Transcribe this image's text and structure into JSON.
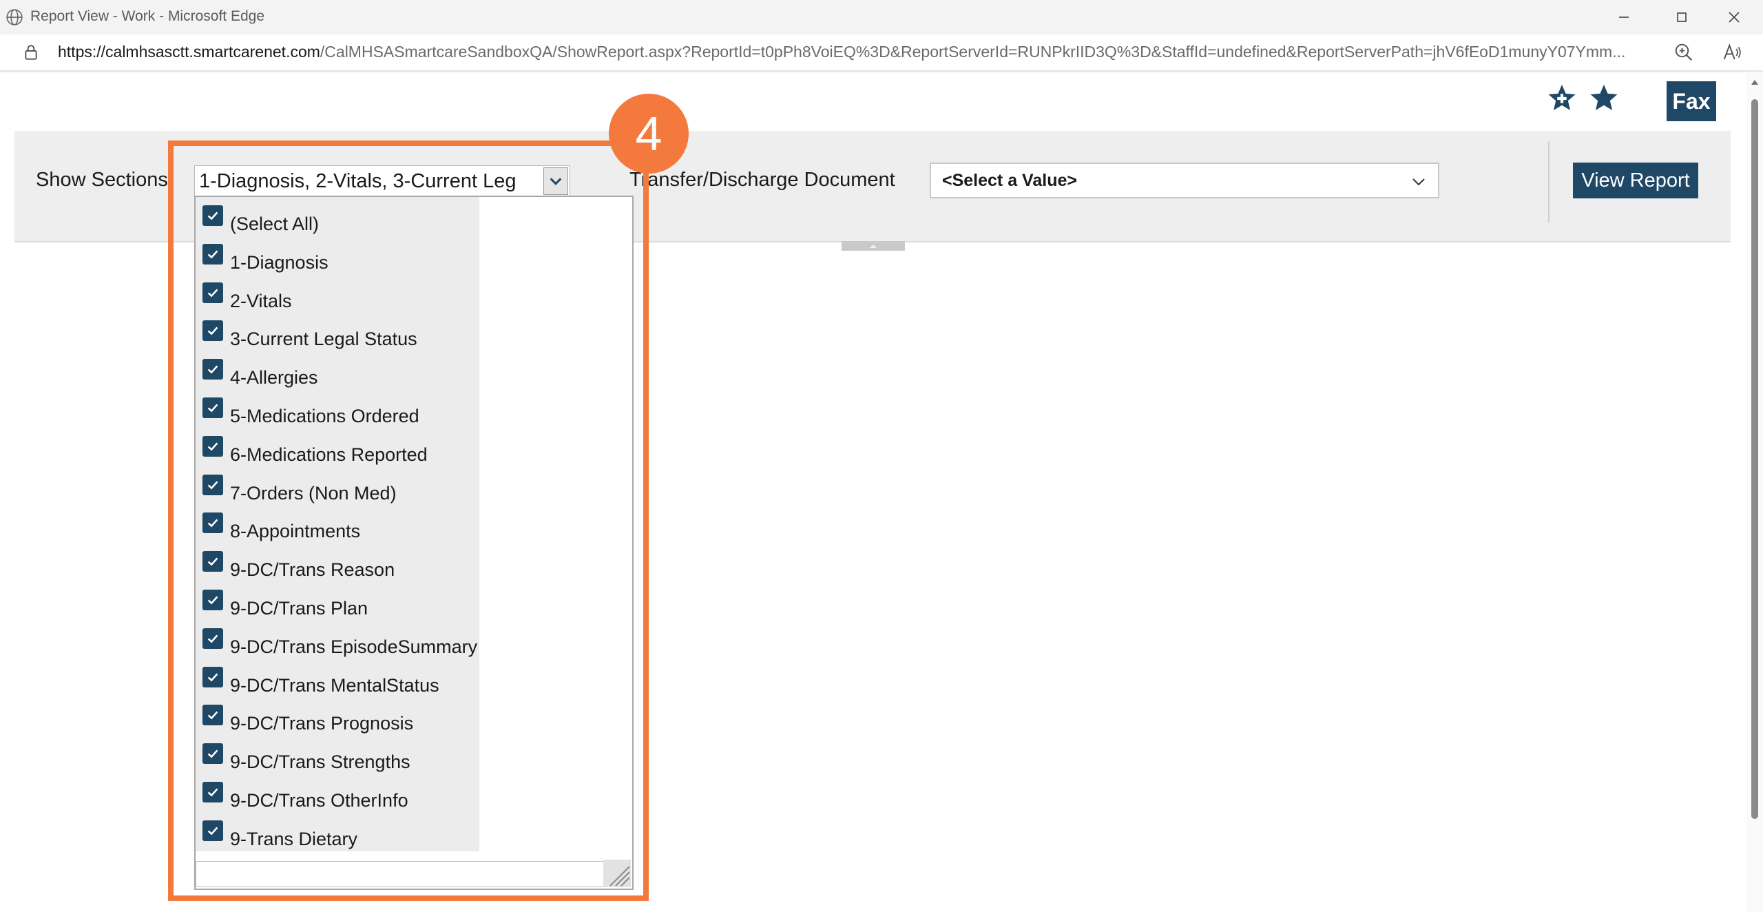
{
  "browser": {
    "window_title": "Report View - Work - Microsoft Edge",
    "url_host": "https://calmhsasctt.smartcarenet.com",
    "url_rest": "/CalMHSASmartcareSandboxQA/ShowReport.aspx?ReportId=t0pPh8VoiEQ%3D&ReportServerId=RUNPkrIID3Q%3D&StaffId=undefined&ReportServerPath=jhV6fEoD1munyY07Ymm..."
  },
  "toolbar": {
    "fax_label": "Fax",
    "icons": [
      "add-favorite-star-icon",
      "favorite-star-icon"
    ]
  },
  "params": {
    "show_sections_label": "Show Sections",
    "show_sections_value": "1-Diagnosis, 2-Vitals, 3-Current Leg",
    "td_label": "Transfer/Discharge Document",
    "td_value": "<Select a Value>",
    "view_report_label": "View Report"
  },
  "dropdown": {
    "items": [
      {
        "label": "(Select All)",
        "checked": true
      },
      {
        "label": "1-Diagnosis",
        "checked": true
      },
      {
        "label": "2-Vitals",
        "checked": true
      },
      {
        "label": "3-Current Legal Status",
        "checked": true
      },
      {
        "label": "4-Allergies",
        "checked": true
      },
      {
        "label": "5-Medications Ordered",
        "checked": true
      },
      {
        "label": "6-Medications Reported",
        "checked": true
      },
      {
        "label": "7-Orders (Non Med)",
        "checked": true
      },
      {
        "label": "8-Appointments",
        "checked": true
      },
      {
        "label": "9-DC/Trans Reason",
        "checked": true
      },
      {
        "label": "9-DC/Trans Plan",
        "checked": true
      },
      {
        "label": "9-DC/Trans EpisodeSummary",
        "checked": true
      },
      {
        "label": "9-DC/Trans MentalStatus",
        "checked": true
      },
      {
        "label": "9-DC/Trans Prognosis",
        "checked": true
      },
      {
        "label": "9-DC/Trans Strengths",
        "checked": true
      },
      {
        "label": "9-DC/Trans OtherInfo",
        "checked": true
      },
      {
        "label": "9-Trans Dietary",
        "checked": true
      }
    ]
  },
  "annotation": {
    "step_number": "4",
    "color": "#f37a3c"
  },
  "colors": {
    "brand_dark": "#1f4866",
    "panel_bg": "#eeeeee"
  }
}
